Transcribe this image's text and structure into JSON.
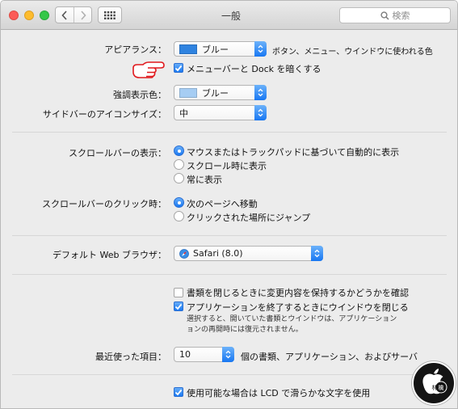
{
  "window": {
    "title": "一般",
    "search_placeholder": "検索"
  },
  "appearance": {
    "label": "アピアランス：",
    "value": "ブルー",
    "swatch_color": "#2f83e0",
    "description": "ボタン、メニュー、ウインドウに使われる色",
    "dark_menu_label": "メニューバーと Dock を暗くする",
    "dark_menu_checked": true
  },
  "highlight": {
    "label": "強調表示色：",
    "value": "ブルー",
    "swatch_color": "#a6cdf3"
  },
  "sidebar_icon_size": {
    "label": "サイドバーのアイコンサイズ：",
    "value": "中"
  },
  "show_scroll_bars": {
    "label": "スクロールバーの表示：",
    "options": [
      {
        "label": "マウスまたはトラックパッドに基づいて自動的に表示",
        "selected": true
      },
      {
        "label": "スクロール時に表示",
        "selected": false
      },
      {
        "label": "常に表示",
        "selected": false
      }
    ]
  },
  "click_scroll_bar": {
    "label": "スクロールバーのクリック時：",
    "options": [
      {
        "label": "次のページへ移動",
        "selected": true
      },
      {
        "label": "クリックされた場所にジャンプ",
        "selected": false
      }
    ]
  },
  "default_browser": {
    "label": "デフォルト Web ブラウザ：",
    "value": "Safari (8.0)"
  },
  "documents": {
    "ask_keep_changes_label": "書類を閉じるときに変更内容を保持するかどうかを確認",
    "ask_keep_changes_checked": false,
    "close_windows_label": "アプリケーションを終了するときにウインドウを閉じる",
    "close_windows_checked": true,
    "close_windows_note_line1": "選択すると、開いていた書類とウインドウは、アプリケーション",
    "close_windows_note_line2": "ョンの再開時には復元されません。"
  },
  "recent_items": {
    "label": "最近使った項目：",
    "value": "10",
    "suffix": "個の書類、アプリケーション、およびサーバ"
  },
  "lcd_smoothing": {
    "label": "使用可能な場合は LCD で滑らかな文字を使用",
    "checked": true
  },
  "watermark": {
    "text": "林檎"
  },
  "colors": {
    "accent": "#1a79f2",
    "hand_red": "#e0191d"
  }
}
